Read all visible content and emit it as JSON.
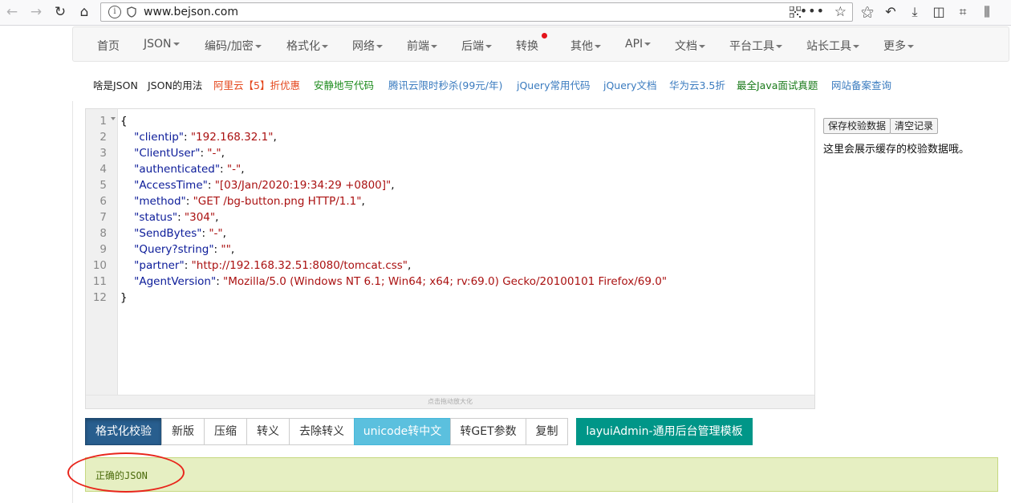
{
  "browser": {
    "url": "www.bejson.com"
  },
  "nav": [
    {
      "label": "首页",
      "caret": false
    },
    {
      "label": "JSON",
      "caret": true
    },
    {
      "label": "编码/加密",
      "caret": true
    },
    {
      "label": "格式化",
      "caret": true
    },
    {
      "label": "网络",
      "caret": true
    },
    {
      "label": "前端",
      "caret": true
    },
    {
      "label": "后端",
      "caret": true
    },
    {
      "label": "转换",
      "caret": false,
      "badge": true
    },
    {
      "label": "其他",
      "caret": true
    },
    {
      "label": "API",
      "caret": true
    },
    {
      "label": "文档",
      "caret": true
    },
    {
      "label": "平台工具",
      "caret": true
    },
    {
      "label": "站长工具",
      "caret": true
    },
    {
      "label": "更多",
      "caret": true
    }
  ],
  "links": [
    {
      "label": "啥是JSON",
      "color": "#222222"
    },
    {
      "label": "JSON的用法",
      "color": "#222222"
    },
    {
      "label": "阿里云【5】折优惠",
      "color": "#e4461b"
    },
    {
      "label": "安静地写代码",
      "color": "#1a8a1a"
    },
    {
      "label": "腾讯云限时秒杀(99元/年)",
      "color": "#3a7bbf"
    },
    {
      "label": "jQuery常用代码",
      "color": "#3a7bbf"
    },
    {
      "label": "jQuery文档",
      "color": "#3a7bbf"
    },
    {
      "label": "华为云3.5折",
      "color": "#3a7bbf"
    },
    {
      "label": "最全Java面试真题",
      "color": "#1a7a1a"
    },
    {
      "label": "网站备案查询",
      "color": "#3a7bbf"
    }
  ],
  "editor": {
    "line_numbers": [
      "1",
      "2",
      "3",
      "4",
      "5",
      "6",
      "7",
      "8",
      "9",
      "10",
      "11",
      "12"
    ],
    "lines": [
      {
        "open": "{"
      },
      {
        "key": "\"clientip\"",
        "value": "\"192.168.32.1\"",
        "comma": true
      },
      {
        "key": "\"ClientUser\"",
        "value": "\"-\"",
        "comma": true
      },
      {
        "key": "\"authenticated\"",
        "value": "\"-\"",
        "comma": true
      },
      {
        "key": "\"AccessTime\"",
        "value": "\"[03/Jan/2020:19:34:29 +0800]\"",
        "comma": true
      },
      {
        "key": "\"method\"",
        "value": "\"GET /bg-button.png HTTP/1.1\"",
        "comma": true
      },
      {
        "key": "\"status\"",
        "value": "\"304\"",
        "comma": true
      },
      {
        "key": "\"SendBytes\"",
        "value": "\"-\"",
        "comma": true
      },
      {
        "key": "\"Query?string\"",
        "value": "\"\"",
        "comma": true
      },
      {
        "key": "\"partner\"",
        "value": "\"http://192.168.32.51:8080/tomcat.css\"",
        "comma": true
      },
      {
        "key": "\"AgentVersion\"",
        "value": "\"Mozilla/5.0 (Windows NT 6.1; Win64; x64; rv:69.0) Gecko/20100101 Firefox/69.0\"",
        "comma": false
      },
      {
        "open": "}"
      }
    ],
    "resize_hint": "点击拖动放大化"
  },
  "right_panel": {
    "save_label": "保存校验数据",
    "clear_label": "清空记录",
    "note": "这里会展示缓存的校验数据哦。"
  },
  "actions": [
    {
      "label": "格式化校验",
      "style": "primary"
    },
    {
      "label": "新版",
      "style": "default"
    },
    {
      "label": "压缩",
      "style": "default"
    },
    {
      "label": "转义",
      "style": "default"
    },
    {
      "label": "去除转义",
      "style": "default"
    },
    {
      "label": "unicode转中文",
      "style": "info"
    },
    {
      "label": "转GET参数",
      "style": "default"
    },
    {
      "label": "复制",
      "style": "default"
    }
  ],
  "promo_button": "layuiAdmin-通用后台管理模板",
  "result": {
    "message": "正确的JSON"
  },
  "colors": {
    "primary": "#285e8e",
    "info": "#5bc0de",
    "teal": "#009688",
    "success_bg": "#e6efc2",
    "annotation": "#e8261c"
  }
}
